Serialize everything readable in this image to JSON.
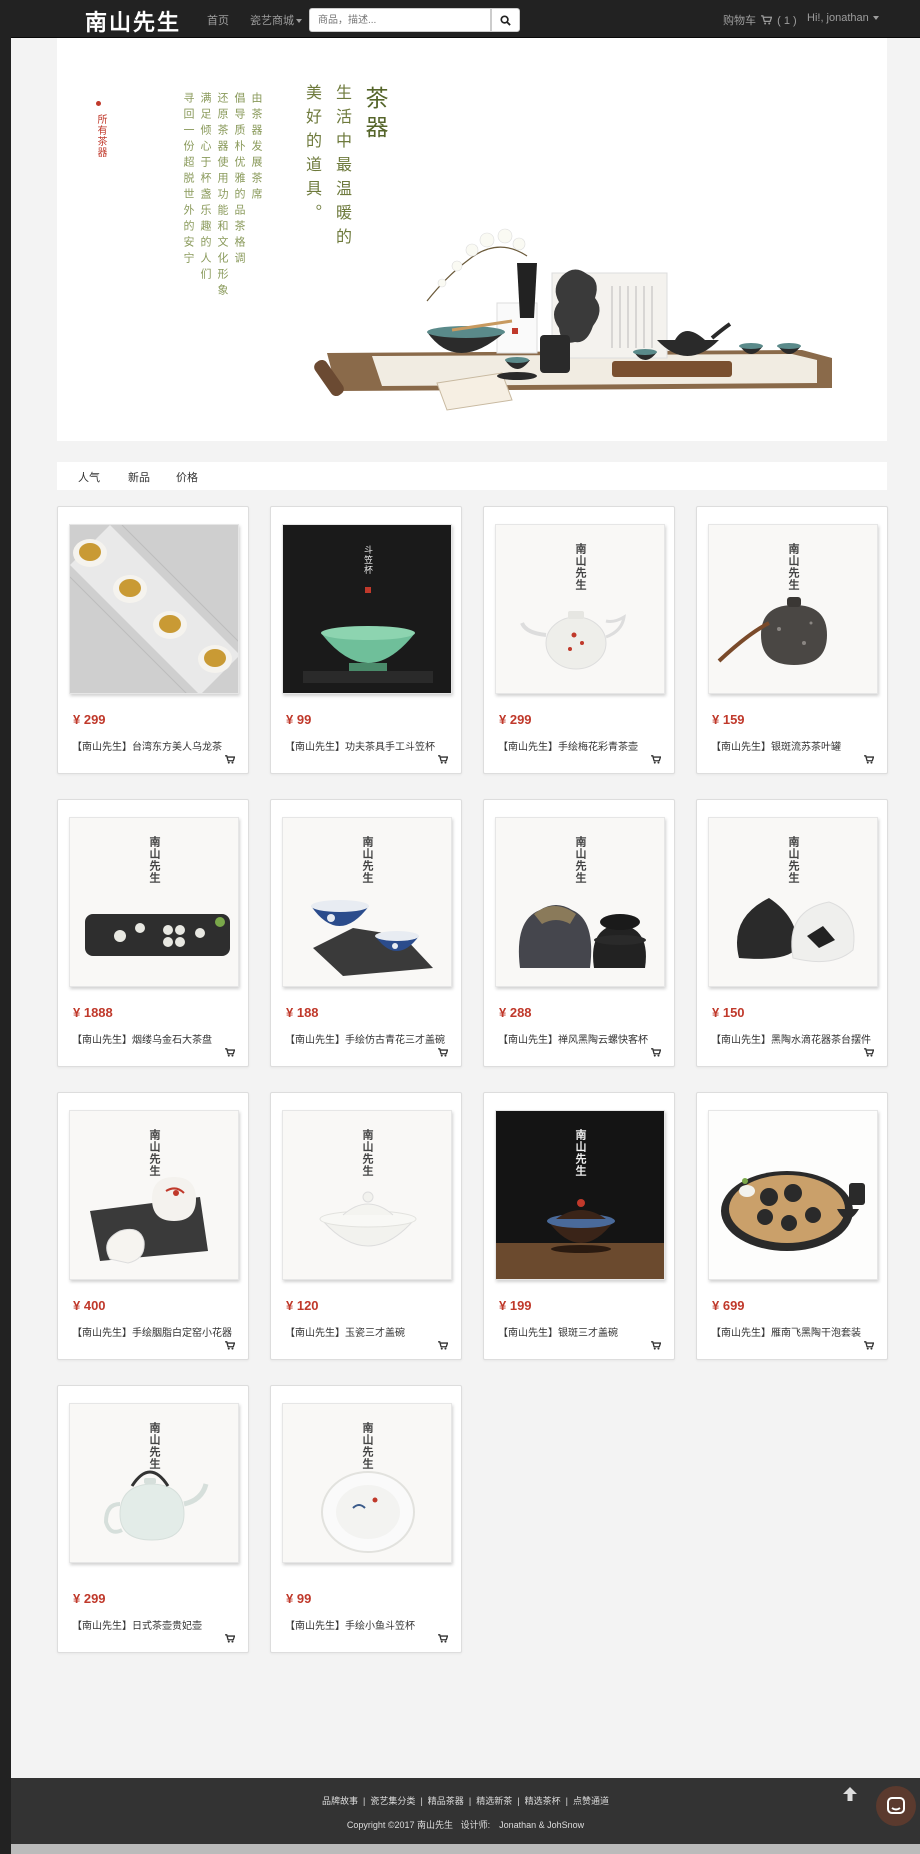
{
  "navbar": {
    "brand": "南山先生",
    "home": "首页",
    "shop": "瓷艺商城",
    "search_placeholder": "商品，描述...",
    "cart": "购物车",
    "cart_count": "( 1 )",
    "user": "Hi!, jonathan"
  },
  "banner": {
    "all_label": "所有茶器",
    "title": "茶器",
    "tagline_1": "生活中最温暖的",
    "tagline_2": "美好的道具。",
    "desc": [
      "由茶器发展茶席",
      "倡导质朴优雅的品茶格调",
      "还原茶器使用功能和文化形象",
      "满足倾心于杯盏乐趣的人们",
      "寻回一份超脱世外的安宁"
    ]
  },
  "filters": [
    "人气",
    "新品",
    "价格"
  ],
  "products": [
    {
      "price": "¥ 299",
      "name": "【南山先生】台湾东方美人乌龙茶",
      "image": "tea-cups"
    },
    {
      "price": "¥ 99",
      "name": "【南山先生】功夫茶具手工斗笠杯",
      "image": "celadon-bowl",
      "image_text": "斗笠杯"
    },
    {
      "price": "¥ 299",
      "name": "【南山先生】手绘梅花彩青茶壶",
      "image": "teapot"
    },
    {
      "price": "¥ 159",
      "name": "【南山先生】银斑流苏茶叶罐",
      "image": "jar"
    },
    {
      "price": "¥ 1888",
      "name": "【南山先生】烟缕乌金石大茶盘",
      "image": "stone-tray"
    },
    {
      "price": "¥ 188",
      "name": "【南山先生】手绘仿古青花三才盖碗",
      "image": "blue-gaiwan"
    },
    {
      "price": "¥ 288",
      "name": "【南山先生】禅风黑陶云螺快客杯",
      "image": "travel-set"
    },
    {
      "price": "¥ 150",
      "name": "【南山先生】黑陶水滴花器茶台摆件",
      "image": "vases"
    },
    {
      "price": "¥ 400",
      "name": "【南山先生】手绘胭脂白定窑小花器",
      "image": "white-vases"
    },
    {
      "price": "¥ 120",
      "name": "【南山先生】玉瓷三才盖碗",
      "image": "white-gaiwan"
    },
    {
      "price": "¥ 199",
      "name": "【南山先生】银斑三才盖碗",
      "image": "dark-gaiwan"
    },
    {
      "price": "¥ 699",
      "name": "【南山先生】雁南飞黑陶干泡套装",
      "image": "tea-set"
    },
    {
      "price": "¥ 299",
      "name": "【南山先生】日式茶壶贵妃壶",
      "image": "jp-teapot"
    },
    {
      "price": "¥ 99",
      "name": "【南山先生】手绘小鱼斗笠杯",
      "image": "fish-cup"
    }
  ],
  "product_logo": "南山先生",
  "footer": {
    "links": [
      "品牌故事",
      "瓷艺集分类",
      "精品茶器",
      "精选新茶",
      "精选茶杯",
      "点赞通道"
    ],
    "copyright": "Copyright ©2017 南山先生",
    "designer": "设计师:　Jonathan & JohSnow"
  }
}
